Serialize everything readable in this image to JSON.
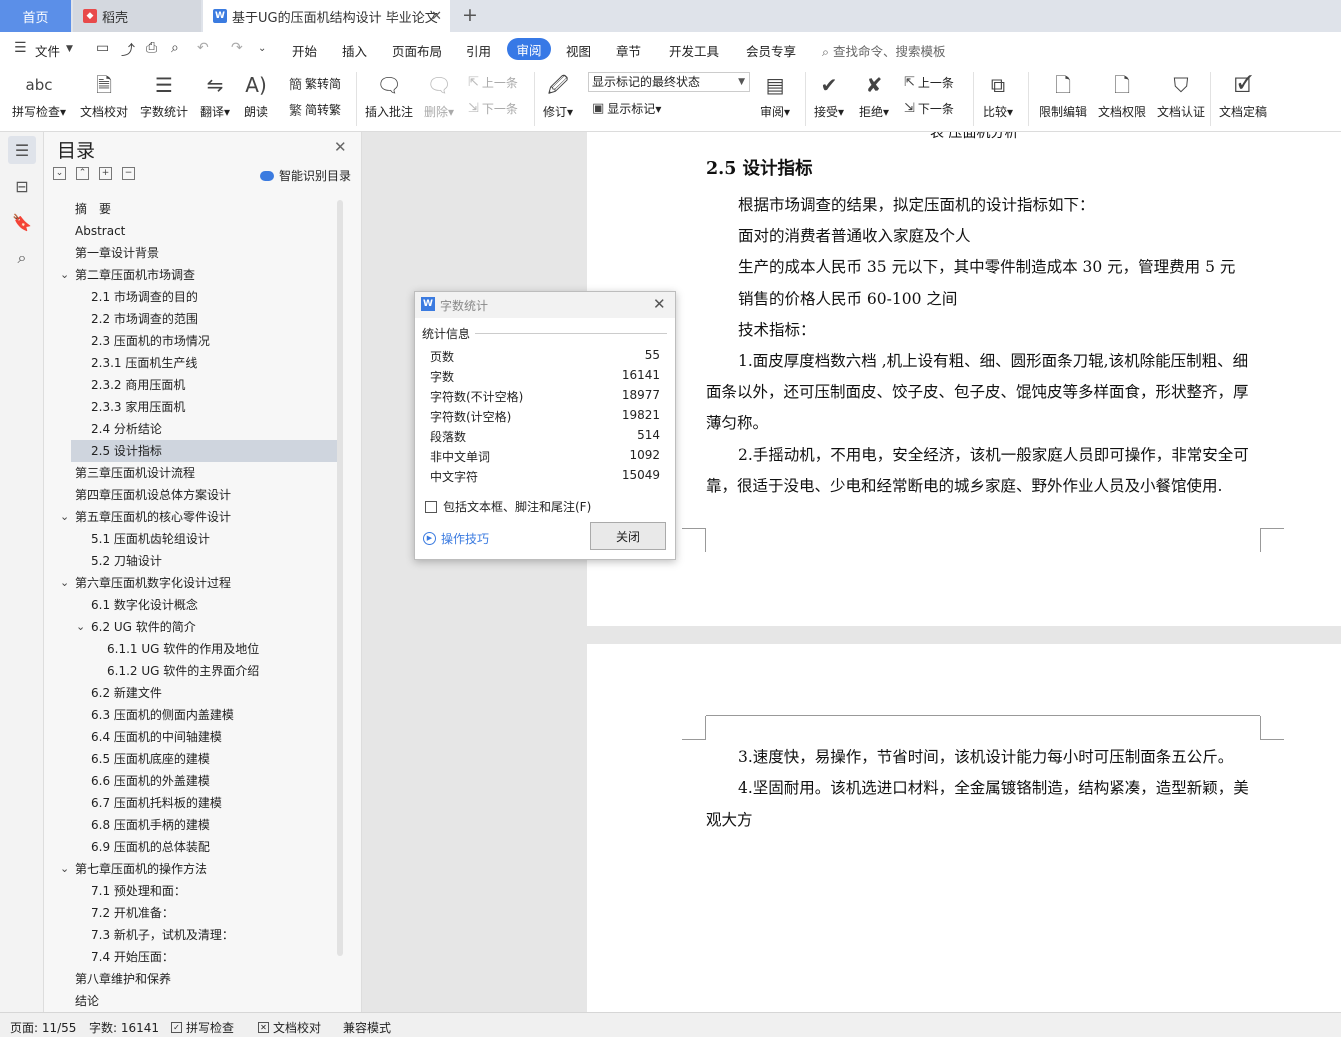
{
  "colors": {
    "accent": "#3779e6",
    "home_tab": "#5b8fe8",
    "shell_icon": "#e84a4a",
    "doc_icon": "#3b7be0"
  },
  "titlebar": {
    "home": "首页",
    "tabs": [
      {
        "label": "稻壳",
        "icon": "daoke-icon"
      },
      {
        "label": "基于UG的压面机结构设计 毕业论文",
        "icon": "wps-writer-icon"
      }
    ],
    "doc_icon_letter": "W"
  },
  "menubar": {
    "file": "文件",
    "items": [
      "开始",
      "插入",
      "页面布局",
      "引用",
      "审阅",
      "视图",
      "章节",
      "开发工具",
      "会员专享"
    ],
    "active": "审阅",
    "search": "查找命令、搜索模板"
  },
  "ribbon": {
    "spell_check": "拼写检查",
    "doc_proof": "文档校对",
    "word_count": "字数统计",
    "translate": "翻译",
    "read_aloud": "朗读",
    "trad_to_simp": "繁转简",
    "simp_to_trad": "简转繁",
    "insert_comment": "插入批注",
    "delete": "删除",
    "prev_comment": "上一条",
    "next_comment": "下一条",
    "track_changes": "修订",
    "markup_state": "显示标记的最终状态",
    "show_markup": "显示标记",
    "review": "审阅",
    "accept": "接受",
    "reject": "拒绝",
    "prev_change": "上一条",
    "next_change": "下一条",
    "compare": "比较",
    "restrict_edit": "限制编辑",
    "doc_permission": "文档权限",
    "doc_certify": "文档认证",
    "doc_finalize": "文档定稿"
  },
  "nav": {
    "title": "目录",
    "smart_toc": "智能识别目录",
    "items": [
      {
        "label": "摘　要",
        "level": 0,
        "chev": ""
      },
      {
        "label": "Abstract",
        "level": 0,
        "chev": ""
      },
      {
        "label": "第一章设计背景",
        "level": 0,
        "chev": ""
      },
      {
        "label": "第二章压面机市场调查",
        "level": 0,
        "chev": "v"
      },
      {
        "label": "2.1 市场调查的目的",
        "level": 1,
        "chev": ""
      },
      {
        "label": "2.2 市场调查的范围",
        "level": 1,
        "chev": ""
      },
      {
        "label": "2.3 压面机的市场情况",
        "level": 1,
        "chev": ""
      },
      {
        "label": "2.3.1 压面机生产线",
        "level": 1,
        "chev": ""
      },
      {
        "label": "2.3.2 商用压面机",
        "level": 1,
        "chev": ""
      },
      {
        "label": "2.3.3 家用压面机",
        "level": 1,
        "chev": ""
      },
      {
        "label": "2.4 分析结论",
        "level": 1,
        "chev": ""
      },
      {
        "label": "2.5 设计指标",
        "level": 1,
        "chev": "",
        "active": true
      },
      {
        "label": "第三章压面机设计流程",
        "level": 0,
        "chev": ""
      },
      {
        "label": "第四章压面机设总体方案设计",
        "level": 0,
        "chev": ""
      },
      {
        "label": "第五章压面机的核心零件设计",
        "level": 0,
        "chev": "v"
      },
      {
        "label": "5.1 压面机齿轮组设计",
        "level": 1,
        "chev": ""
      },
      {
        "label": "5.2 刀轴设计",
        "level": 1,
        "chev": ""
      },
      {
        "label": "第六章压面机数字化设计过程",
        "level": 0,
        "chev": "v"
      },
      {
        "label": "6.1 数字化设计概念",
        "level": 1,
        "chev": ""
      },
      {
        "label": "6.2 UG 软件的简介",
        "level": 1,
        "chev": "v"
      },
      {
        "label": "6.1.1 UG 软件的作用及地位",
        "level": 2,
        "chev": ""
      },
      {
        "label": "6.1.2 UG 软件的主界面介绍",
        "level": 2,
        "chev": ""
      },
      {
        "label": "6.2 新建文件",
        "level": 1,
        "chev": ""
      },
      {
        "label": "6.3 压面机的侧面内盖建模",
        "level": 1,
        "chev": ""
      },
      {
        "label": "6.4 压面机的中间轴建模",
        "level": 1,
        "chev": ""
      },
      {
        "label": "6.5 压面机底座的建模",
        "level": 1,
        "chev": ""
      },
      {
        "label": "6.6 压面机的外盖建模",
        "level": 1,
        "chev": ""
      },
      {
        "label": "6.7 压面机托料板的建模",
        "level": 1,
        "chev": ""
      },
      {
        "label": "6.8 压面机手柄的建模",
        "level": 1,
        "chev": ""
      },
      {
        "label": "6.9 压面机的总体装配",
        "level": 1,
        "chev": ""
      },
      {
        "label": "第七章压面机的操作方法",
        "level": 0,
        "chev": "v"
      },
      {
        "label": "7.1 预处理和面：",
        "level": 1,
        "chev": ""
      },
      {
        "label": "7.2 开机准备：",
        "level": 1,
        "chev": ""
      },
      {
        "label": "7.3 新机子，试机及清理：",
        "level": 1,
        "chev": ""
      },
      {
        "label": "7.4 开始压面：",
        "level": 1,
        "chev": ""
      },
      {
        "label": "第八章维护和保养",
        "level": 0,
        "chev": ""
      },
      {
        "label": "结论",
        "level": 0,
        "chev": ""
      }
    ]
  },
  "document": {
    "clipped_caption": "表 压面机分析",
    "heading": "2.5 设计指标",
    "page1_lines": [
      "根据市场调查的结果，拟定压面机的设计指标如下：",
      "面对的消费者普通收入家庭及个人",
      "生产的成本人民币 35 元以下，其中零件制造成本 30 元，管理费用 5 元",
      "销售的价格人民币 60-100 之间",
      "技术指标：",
      "1.面皮厚度档数六档 ,机上设有粗、细、圆形面条刀辊,该机除能压制粗、细",
      "面条以外，还可压制面皮、饺子皮、包子皮、馄饨皮等多样面食，形状整齐，厚",
      "薄匀称。",
      "2.手摇动机，不用电，安全经济，该机一般家庭人员即可操作，非常安全可",
      "靠，很适于没电、少电和经常断电的城乡家庭、野外作业人员及小餐馆使用."
    ],
    "page2_lines": [
      "3.速度快，易操作，节省时间，该机设计能力每小时可压制面条五公斤。",
      "4.坚固耐用。该机选进口材料，全金属镀铬制造，结构紧凑，造型新颖，美",
      "观大方"
    ]
  },
  "dialog": {
    "title": "字数统计",
    "section": "统计信息",
    "rows": [
      {
        "label": "页数",
        "value": "55"
      },
      {
        "label": "字数",
        "value": "16141"
      },
      {
        "label": "字符数(不计空格)",
        "value": "18977"
      },
      {
        "label": "字符数(计空格)",
        "value": "19821"
      },
      {
        "label": "段落数",
        "value": "514"
      },
      {
        "label": "非中文单词",
        "value": "1092"
      },
      {
        "label": "中文字符",
        "value": "15049"
      }
    ],
    "checkbox_label": "包括文本框、脚注和尾注(F)",
    "tips": "操作技巧",
    "close_button": "关闭"
  },
  "status": {
    "page": "页面: 11/55",
    "words": "字数: 16141",
    "spell": "拼写检查",
    "proof": "文档校对",
    "compat": "兼容模式"
  }
}
